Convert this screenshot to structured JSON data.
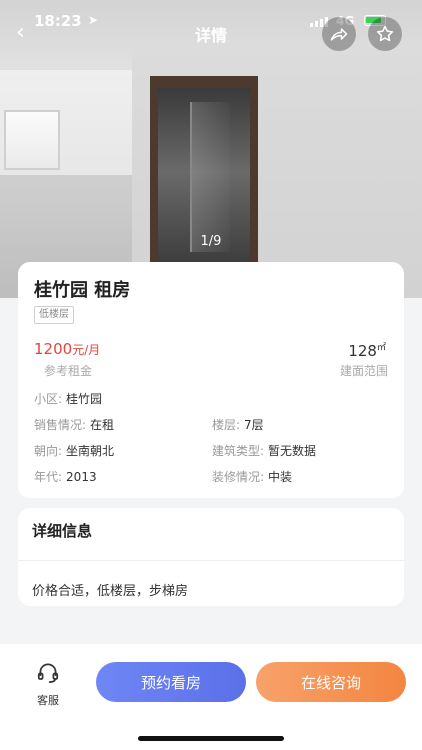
{
  "status_bar": {
    "time": "18:23",
    "network": "4G"
  },
  "nav": {
    "title": "详情"
  },
  "gallery": {
    "counter": "1/9"
  },
  "house": {
    "title": "桂竹园 租房",
    "tag": "低楼层",
    "rent_value": "1200",
    "rent_unit": "元/月",
    "rent_label": "参考租金",
    "area_value": "128",
    "area_unit": "㎡",
    "area_label": "建面范围"
  },
  "attributes": {
    "community": {
      "label": "小区:",
      "value": "桂竹园"
    },
    "sale_status": {
      "label": "销售情况:",
      "value": "在租"
    },
    "floor": {
      "label": "楼层:",
      "value": "7层"
    },
    "orientation": {
      "label": "朝向:",
      "value": "坐南朝北"
    },
    "building_type": {
      "label": "建筑类型:",
      "value": "暂无数据"
    },
    "year": {
      "label": "年代:",
      "value": "2013"
    },
    "decoration": {
      "label": "装修情况:",
      "value": "中装"
    }
  },
  "detail": {
    "title": "详细信息",
    "text": "价格合适，低楼层，步梯房"
  },
  "bottom": {
    "service_label": "客服",
    "appoint_label": "预约看房",
    "consult_label": "在线咨询"
  },
  "colors": {
    "price": "#e2453c",
    "appoint_button": "#6a7ff0",
    "consult_button": "#f5914e"
  },
  "icons": [
    "back-icon",
    "share-icon",
    "star-icon",
    "headset-icon",
    "location-arrow-icon",
    "signal-icon",
    "battery-icon"
  ]
}
